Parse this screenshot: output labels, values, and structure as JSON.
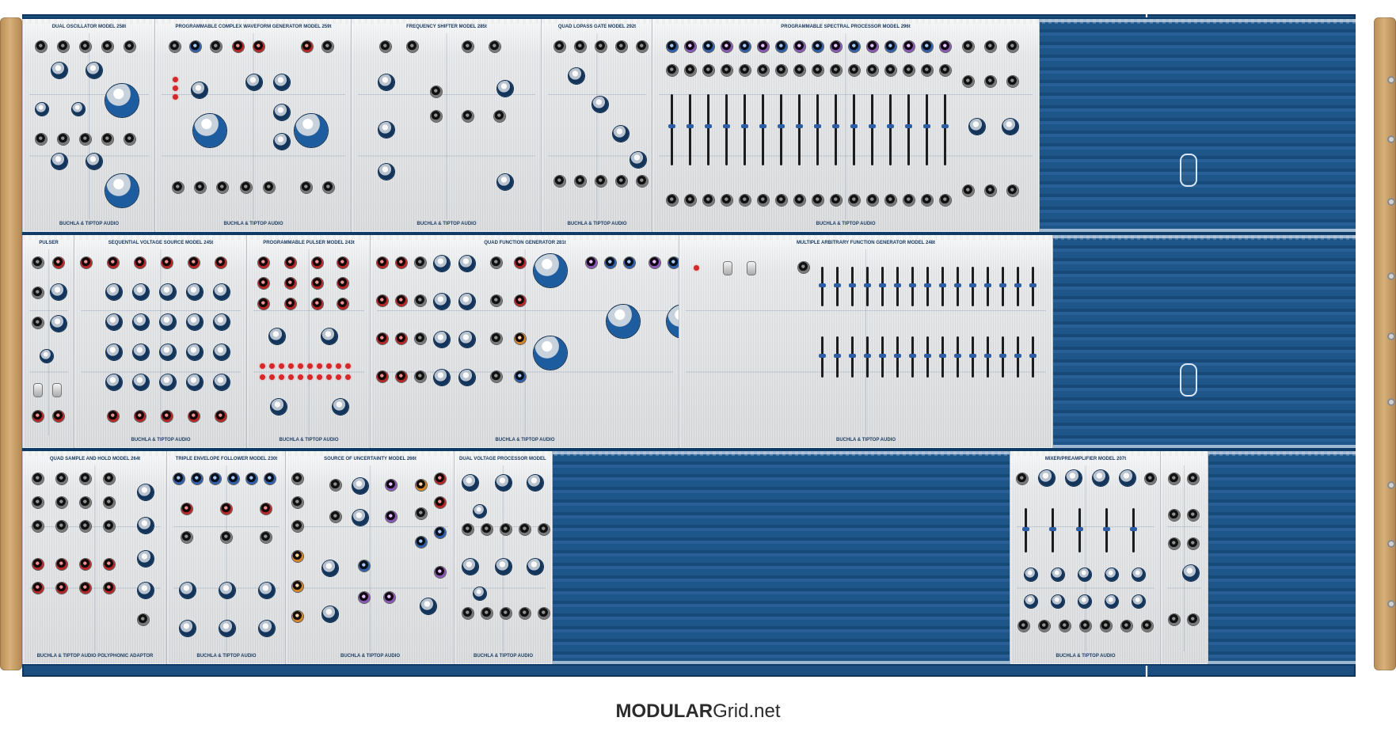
{
  "footer": {
    "brand_left": "MODULAR",
    "brand_right": "Grid.net"
  },
  "rows": [
    {
      "modules": [
        {
          "title": "DUAL OSCILLATOR MODEL 258t",
          "brand": "BUCHLA & TIPTOP AUDIO"
        },
        {
          "title": "PROGRAMMABLE COMPLEX WAVEFORM GENERATOR MODEL 259t",
          "brand": "BUCHLA & TIPTOP AUDIO"
        },
        {
          "title": "FREQUENCY SHIFTER MODEL 285t",
          "brand": "BUCHLA & TIPTOP AUDIO"
        },
        {
          "title": "QUAD LOPASS GATE MODEL 292t",
          "brand": "BUCHLA & TIPTOP AUDIO"
        },
        {
          "title": "PROGRAMMABLE SPECTRAL PROCESSOR MODEL 296t",
          "brand": "BUCHLA & TIPTOP AUDIO"
        }
      ]
    },
    {
      "modules": [
        {
          "title": "PULSER",
          "brand": ""
        },
        {
          "title": "SEQUENTIAL VOLTAGE SOURCE MODEL 245t",
          "brand": "BUCHLA & TIPTOP AUDIO"
        },
        {
          "title": "PROGRAMMABLE PULSER MODEL 243t",
          "brand": "BUCHLA & TIPTOP AUDIO"
        },
        {
          "title": "QUAD FUNCTION GENERATOR 281t",
          "brand": "BUCHLA & TIPTOP AUDIO"
        },
        {
          "title": "MULTIPLE ARBITRARY FUNCTION GENERATOR MODEL 248t",
          "brand": "BUCHLA & TIPTOP AUDIO"
        }
      ]
    },
    {
      "modules": [
        {
          "title": "QUAD SAMPLE AND HOLD MODEL 264t",
          "brand": "BUCHLA & TIPTOP AUDIO POLYPHONIC ADAPTOR"
        },
        {
          "title": "TRIPLE ENVELOPE FOLLOWER MODEL 230t",
          "brand": "BUCHLA & TIPTOP AUDIO"
        },
        {
          "title": "SOURCE OF UNCERTAINTY MODEL 266t",
          "brand": "BUCHLA & TIPTOP AUDIO"
        },
        {
          "title": "DUAL VOLTAGE PROCESSOR MODEL 257t",
          "brand": "BUCHLA & TIPTOP AUDIO"
        },
        {
          "title": "MIXER/PREAMPLIFIER MODEL 207t",
          "brand": "BUCHLA & TIPTOP AUDIO"
        }
      ]
    }
  ]
}
